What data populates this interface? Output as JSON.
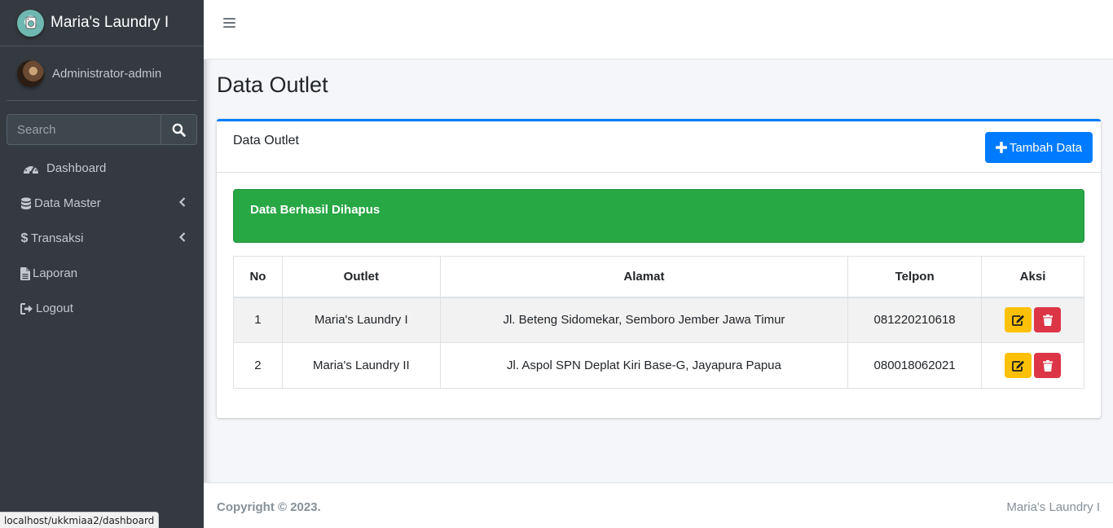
{
  "sidebar": {
    "brand": "Maria's Laundry I",
    "user": "Administrator-admin",
    "search_placeholder": "Search",
    "items": [
      {
        "label": "Dashboard",
        "icon": "tachometer-icon"
      },
      {
        "label": "Data Master",
        "icon": "database-icon"
      },
      {
        "label": "Transaksi",
        "icon": "dollar-icon"
      },
      {
        "label": "Laporan",
        "icon": "file-icon"
      },
      {
        "label": "Logout",
        "icon": "sign-out-icon"
      }
    ]
  },
  "status_url": "localhost/ukkmiaa2/dashboard",
  "page": {
    "title": "Data Outlet"
  },
  "card": {
    "title": "Data Outlet",
    "add_button": "Tambah Data",
    "alert": "Data Berhasil Dihapus"
  },
  "table": {
    "headers": [
      "No",
      "Outlet",
      "Alamat",
      "Telpon",
      "Aksi"
    ],
    "rows": [
      {
        "no": "1",
        "outlet": "Maria's Laundry I",
        "alamat": "Jl. Beteng Sidomekar, Semboro Jember Jawa Timur",
        "telpon": "081220210618"
      },
      {
        "no": "2",
        "outlet": "Maria's Laundry II",
        "alamat": "Jl. Aspol SPN Deplat Kiri Base-G, Jayapura Papua",
        "telpon": "080018062021"
      }
    ]
  },
  "footer": {
    "copyright": "Copyright © 2023.",
    "brand": "Maria's Laundry I"
  },
  "colors": {
    "sidebar": "#343a40",
    "primary": "#007bff",
    "success": "#28a745",
    "warning": "#ffc107",
    "danger": "#dc3545"
  }
}
